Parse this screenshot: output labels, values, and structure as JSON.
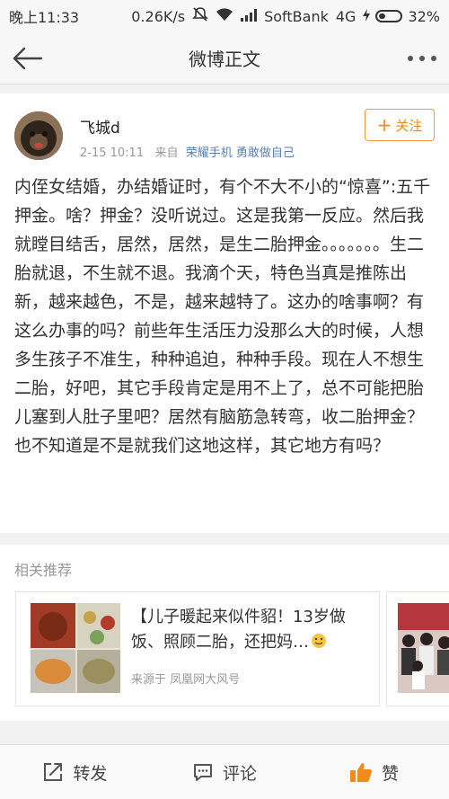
{
  "status_bar": {
    "time": "晚上11:33",
    "speed": "0.26K/s",
    "carrier": "SoftBank",
    "network": "4G",
    "battery": "32%",
    "battery_level": 0.32
  },
  "nav": {
    "title": "微博正文",
    "back_icon": "back-arrow-icon",
    "more_icon": "more-dots-icon"
  },
  "post": {
    "username": "飞城d",
    "date": "2-15 10:11",
    "from_label": "来自",
    "source": "荣耀手机 勇敢做自己",
    "follow_label": "关注",
    "text": "内侄女结婚，办结婚证时，有个不大不小的“惊喜”:五千押金。啥？押金？没听说过。这是我第一反应。然后我就瞠目结舌，居然，居然，是生二胎押金。。。。。。。生二胎就退，不生就不退。我滴个天，特色当真是推陈出新，越来越色，不是，越来越特了。这办的啥事啊？有这么办事的吗？前些年生活压力没那么大的时候，人想多生孩子不准生，种种追迫，种种手段。现在人不想生二胎，好吧，其它手段肯定是用不上了，总不可能把胎儿塞到人肚子里吧？居然有脑筋急转弯，收二胎押金？也不知道是不是就我们这地这样，其它地方有吗？"
  },
  "related": {
    "title": "相关推荐",
    "items": [
      {
        "headline": "【儿子暖起来似件貂！13岁做饭、照顾二胎，还把妈…",
        "source": "来源于 凤凰网大风号"
      }
    ]
  },
  "bottom_bar": {
    "repost": "转发",
    "comment": "评论",
    "like": "赞"
  },
  "colors": {
    "accent": "#f08a1c",
    "link": "#5a7fb2",
    "like": "#f08a1c"
  }
}
